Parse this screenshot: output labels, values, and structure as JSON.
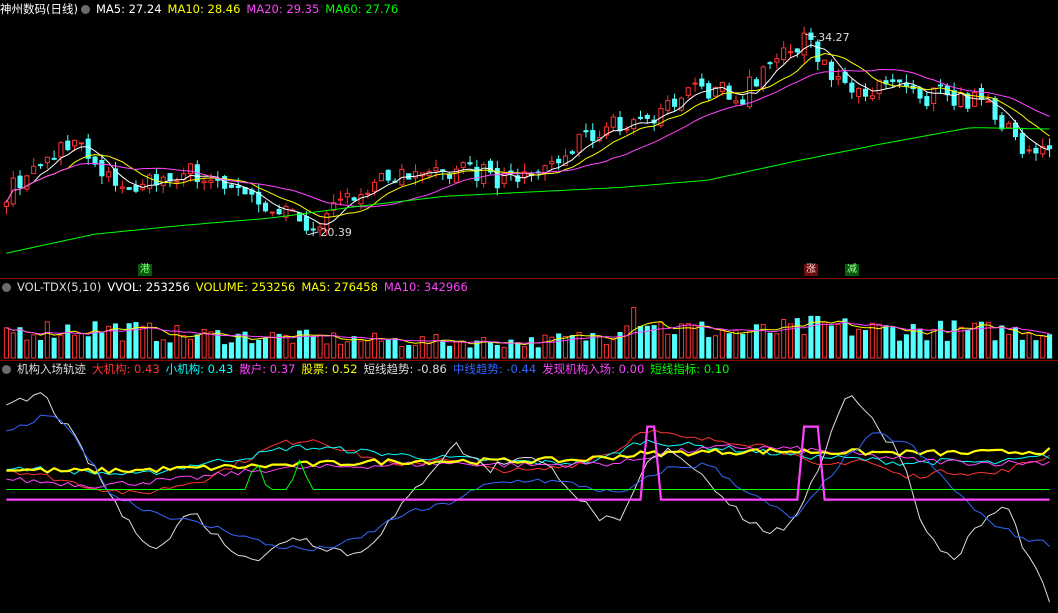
{
  "main_header": {
    "title": "神州数码(日线)",
    "items": [
      {
        "label": "MA5: 27.24",
        "color": "#ffffff"
      },
      {
        "label": "MA10: 28.46",
        "color": "#ffff00"
      },
      {
        "label": "MA20: 29.35",
        "color": "#ff44ff"
      },
      {
        "label": "MA60: 27.76",
        "color": "#00ff00"
      }
    ]
  },
  "vol_header": {
    "title": "VOL-TDX(5,10)",
    "items": [
      {
        "label": "VVOL: 253256",
        "color": "#ffffff"
      },
      {
        "label": "VOLUME: 253256",
        "color": "#ffff00"
      },
      {
        "label": "MA5: 276458",
        "color": "#ffff00"
      },
      {
        "label": "MA10: 342966",
        "color": "#ff44ff"
      }
    ]
  },
  "ind_header": {
    "title": "机构入场轨迹",
    "items": [
      {
        "label": "大机构: 0.43",
        "color": "#ff3333"
      },
      {
        "label": "小机构: 0.43",
        "color": "#00ffff"
      },
      {
        "label": "散户: 0.37",
        "color": "#ff44ff"
      },
      {
        "label": "股票: 0.52",
        "color": "#ffff00"
      },
      {
        "label": "短线趋势: -0.86",
        "color": "#dddddd"
      },
      {
        "label": "中线趋势: -0.44",
        "color": "#3366ff"
      },
      {
        "label": "发现机构入场: 0.00",
        "color": "#ff44ff"
      },
      {
        "label": "短线指标: 0.10",
        "color": "#00ff00"
      }
    ]
  },
  "markers": {
    "gang": "港",
    "zhang": "涨",
    "jian": "减"
  },
  "annotations": {
    "high": "34.27",
    "low": "20.39"
  },
  "chart_data": {
    "type": "candlestick",
    "price_range": [
      18.6,
      35.3
    ],
    "bars": 154,
    "close_anchors": [
      [
        0,
        23.4
      ],
      [
        8,
        25.2
      ],
      [
        15,
        27.2
      ],
      [
        22,
        24.3
      ],
      [
        30,
        23.7
      ],
      [
        40,
        24.9
      ],
      [
        50,
        24.0
      ],
      [
        60,
        22.3
      ],
      [
        70,
        21.2
      ],
      [
        77,
        22.5
      ],
      [
        85,
        24.7
      ],
      [
        95,
        24.1
      ],
      [
        105,
        25.1
      ],
      [
        115,
        24.0
      ],
      [
        125,
        25.4
      ],
      [
        135,
        27.6
      ],
      [
        142,
        28.2
      ],
      [
        148,
        28.8
      ],
      [
        155,
        30.1
      ],
      [
        160,
        30.5
      ],
      [
        168,
        30.1
      ],
      [
        175,
        32.5
      ],
      [
        182,
        33.6
      ],
      [
        185,
        32.9
      ],
      [
        190,
        31.0
      ],
      [
        200,
        30.4
      ],
      [
        207,
        30.6
      ],
      [
        210,
        29.0
      ],
      [
        212,
        30.7
      ],
      [
        215,
        29.2
      ],
      [
        220,
        29.8
      ],
      [
        224,
        29.2
      ],
      [
        228,
        28.0
      ],
      [
        232,
        26.0
      ],
      [
        238,
        26.8
      ]
    ],
    "ma60_anchors": [
      [
        0,
        19.2
      ],
      [
        20,
        20.5
      ],
      [
        40,
        21.1
      ],
      [
        60,
        21.6
      ],
      [
        80,
        22.4
      ],
      [
        100,
        23.1
      ],
      [
        120,
        23.4
      ],
      [
        140,
        23.7
      ],
      [
        160,
        24.2
      ],
      [
        180,
        25.5
      ],
      [
        200,
        26.7
      ],
      [
        220,
        27.8
      ],
      [
        238,
        27.7
      ]
    ],
    "volume_range": [
      0,
      620000
    ],
    "volume_anchors": [
      [
        0,
        270000
      ],
      [
        20,
        300000
      ],
      [
        40,
        230000
      ],
      [
        60,
        210000
      ],
      [
        90,
        170000
      ],
      [
        120,
        160000
      ],
      [
        138,
        230000
      ],
      [
        142,
        530000
      ],
      [
        150,
        300000
      ],
      [
        170,
        250000
      ],
      [
        185,
        310000
      ],
      [
        200,
        280000
      ],
      [
        220,
        270000
      ],
      [
        238,
        260000
      ]
    ],
    "indicator_range": [
      -1.05,
      1.2
    ],
    "series": [
      {
        "name": "大机构",
        "color": "#ff3333",
        "anchors": [
          [
            0,
            0.3
          ],
          [
            10,
            0.22
          ],
          [
            20,
            0.12
          ],
          [
            30,
            0.05
          ],
          [
            45,
            0.2
          ],
          [
            55,
            0.4
          ],
          [
            62,
            0.55
          ],
          [
            70,
            0.6
          ],
          [
            80,
            0.45
          ],
          [
            90,
            0.32
          ],
          [
            100,
            0.42
          ],
          [
            110,
            0.3
          ],
          [
            120,
            0.28
          ],
          [
            130,
            0.35
          ],
          [
            140,
            0.5
          ],
          [
            145,
            0.7
          ],
          [
            155,
            0.6
          ],
          [
            165,
            0.58
          ],
          [
            175,
            0.52
          ],
          [
            185,
            0.32
          ],
          [
            195,
            0.4
          ],
          [
            205,
            0.22
          ],
          [
            215,
            0.28
          ],
          [
            225,
            0.25
          ],
          [
            238,
            0.43
          ]
        ]
      },
      {
        "name": "小机构",
        "color": "#00ffff",
        "anchors": [
          [
            0,
            0.32
          ],
          [
            15,
            0.28
          ],
          [
            30,
            0.24
          ],
          [
            45,
            0.36
          ],
          [
            55,
            0.42
          ],
          [
            65,
            0.52
          ],
          [
            75,
            0.5
          ],
          [
            85,
            0.46
          ],
          [
            95,
            0.42
          ],
          [
            105,
            0.4
          ],
          [
            115,
            0.38
          ],
          [
            125,
            0.36
          ],
          [
            135,
            0.38
          ],
          [
            145,
            0.58
          ],
          [
            155,
            0.54
          ],
          [
            165,
            0.5
          ],
          [
            175,
            0.46
          ],
          [
            185,
            0.42
          ],
          [
            195,
            0.4
          ],
          [
            205,
            0.36
          ],
          [
            215,
            0.38
          ],
          [
            225,
            0.36
          ],
          [
            238,
            0.43
          ]
        ]
      },
      {
        "name": "散户",
        "color": "#ff44ff",
        "anchors": [
          [
            0,
            0.2
          ],
          [
            20,
            0.14
          ],
          [
            40,
            0.2
          ],
          [
            60,
            0.3
          ],
          [
            80,
            0.33
          ],
          [
            100,
            0.36
          ],
          [
            120,
            0.34
          ],
          [
            140,
            0.36
          ],
          [
            150,
            0.46
          ],
          [
            165,
            0.52
          ],
          [
            180,
            0.5
          ],
          [
            195,
            0.44
          ],
          [
            210,
            0.38
          ],
          [
            225,
            0.36
          ],
          [
            238,
            0.37
          ]
        ]
      },
      {
        "name": "股票",
        "color": "#ffff00",
        "anchors": [
          [
            0,
            0.3
          ],
          [
            15,
            0.28
          ],
          [
            30,
            0.29
          ],
          [
            50,
            0.32
          ],
          [
            70,
            0.35
          ],
          [
            90,
            0.38
          ],
          [
            110,
            0.38
          ],
          [
            130,
            0.39
          ],
          [
            145,
            0.45
          ],
          [
            160,
            0.47
          ],
          [
            175,
            0.48
          ],
          [
            190,
            0.47
          ],
          [
            205,
            0.46
          ],
          [
            220,
            0.46
          ],
          [
            238,
            0.48
          ]
        ]
      },
      {
        "name": "短线趋势",
        "color": "#dddddd",
        "anchors": [
          [
            0,
            0.9
          ],
          [
            8,
            1.05
          ],
          [
            14,
            0.7
          ],
          [
            20,
            0.3
          ],
          [
            28,
            -0.25
          ],
          [
            35,
            -0.5
          ],
          [
            42,
            -0.1
          ],
          [
            50,
            -0.45
          ],
          [
            58,
            -0.6
          ],
          [
            65,
            -0.35
          ],
          [
            72,
            -0.45
          ],
          [
            80,
            -0.55
          ],
          [
            88,
            -0.2
          ],
          [
            96,
            0.25
          ],
          [
            102,
            0.55
          ],
          [
            110,
            0.3
          ],
          [
            118,
            0.45
          ],
          [
            126,
            0.25
          ],
          [
            134,
            -0.15
          ],
          [
            140,
            -0.25
          ],
          [
            146,
            0.35
          ],
          [
            152,
            0.5
          ],
          [
            160,
            0.2
          ],
          [
            170,
            -0.25
          ],
          [
            178,
            -0.35
          ],
          [
            186,
            0.4
          ],
          [
            192,
            1.1
          ],
          [
            198,
            0.75
          ],
          [
            204,
            0.45
          ],
          [
            210,
            -0.35
          ],
          [
            216,
            -0.6
          ],
          [
            222,
            -0.25
          ],
          [
            228,
            -0.05
          ],
          [
            234,
            -0.65
          ],
          [
            238,
            -0.98
          ]
        ]
      },
      {
        "name": "中线趋势",
        "color": "#3366ff",
        "anchors": [
          [
            0,
            0.65
          ],
          [
            10,
            0.85
          ],
          [
            16,
            0.6
          ],
          [
            24,
            0.05
          ],
          [
            32,
            -0.1
          ],
          [
            40,
            -0.2
          ],
          [
            50,
            -0.3
          ],
          [
            60,
            -0.45
          ],
          [
            70,
            -0.5
          ],
          [
            80,
            -0.4
          ],
          [
            90,
            -0.15
          ],
          [
            100,
            -0.05
          ],
          [
            110,
            0.15
          ],
          [
            120,
            0.2
          ],
          [
            130,
            0.15
          ],
          [
            140,
            0.05
          ],
          [
            150,
            0.3
          ],
          [
            160,
            0.35
          ],
          [
            170,
            0.05
          ],
          [
            180,
            -0.2
          ],
          [
            190,
            0.35
          ],
          [
            198,
            0.65
          ],
          [
            206,
            0.55
          ],
          [
            214,
            0.2
          ],
          [
            222,
            -0.15
          ],
          [
            230,
            -0.35
          ],
          [
            238,
            -0.44
          ]
        ]
      },
      {
        "name": "短线指标",
        "color": "#00ff00",
        "anchors": [
          [
            0,
            0.1
          ],
          [
            238,
            0.1
          ]
        ]
      },
      {
        "name": "发现机构入场",
        "color": "#ff44ff",
        "anchors": [
          [
            0,
            0.0
          ],
          [
            238,
            0.0
          ]
        ]
      }
    ],
    "signals": {
      "短线指标": [
        57,
        67
      ],
      "发现机构入场": [
        147,
        183
      ]
    }
  }
}
